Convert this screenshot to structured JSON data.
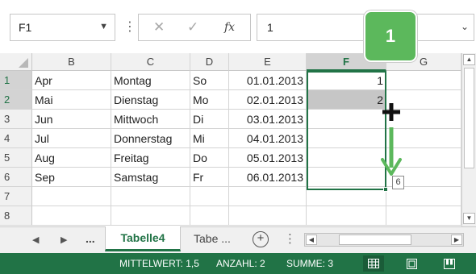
{
  "formula_bar": {
    "name_box": "F1",
    "name_box_dropdown": "▼",
    "separator": "⋮",
    "cancel_icon": "✕",
    "enter_icon": "✓",
    "fx_label": "fx",
    "formula": "1",
    "expand_icon": "⌄"
  },
  "callout": {
    "label": "1",
    "color": "#5cb85c"
  },
  "columns": [
    "B",
    "C",
    "D",
    "E",
    "F",
    "G"
  ],
  "selected_column": "F",
  "rows": [
    {
      "num": "1",
      "B": "Apr",
      "C": "Montag",
      "D": "So",
      "E": "01.01.2013",
      "F": "1",
      "G": ""
    },
    {
      "num": "2",
      "B": "Mai",
      "C": "Dienstag",
      "D": "Mo",
      "E": "02.01.2013",
      "F": "2",
      "G": ""
    },
    {
      "num": "3",
      "B": "Jun",
      "C": "Mittwoch",
      "D": "Di",
      "E": "03.01.2013",
      "F": "",
      "G": ""
    },
    {
      "num": "4",
      "B": "Jul",
      "C": "Donnerstag",
      "D": "Mi",
      "E": "04.01.2013",
      "F": "",
      "G": ""
    },
    {
      "num": "5",
      "B": "Aug",
      "C": "Freitag",
      "D": "Do",
      "E": "05.01.2013",
      "F": "",
      "G": ""
    },
    {
      "num": "6",
      "B": "Sep",
      "C": "Samstag",
      "D": "Fr",
      "E": "06.01.2013",
      "F": "",
      "G": ""
    },
    {
      "num": "7",
      "B": "",
      "C": "",
      "D": "",
      "E": "",
      "F": "",
      "G": ""
    },
    {
      "num": "8",
      "B": "",
      "C": "",
      "D": "",
      "E": "",
      "F": "",
      "G": ""
    }
  ],
  "autofill_tooltip": "6",
  "sheet_tabs": {
    "prev": "◀",
    "next": "▶",
    "more": "...",
    "active": "Tabelle4",
    "other": "Tabe ...",
    "add": "+",
    "separator": "⋮"
  },
  "status_bar": {
    "average": "MITTELWERT: 1,5",
    "count": "ANZAHL: 2",
    "sum": "SUMME: 3",
    "color": "#217346"
  },
  "colors": {
    "excel_green": "#217346",
    "fill_arrow": "#5cb85c"
  }
}
